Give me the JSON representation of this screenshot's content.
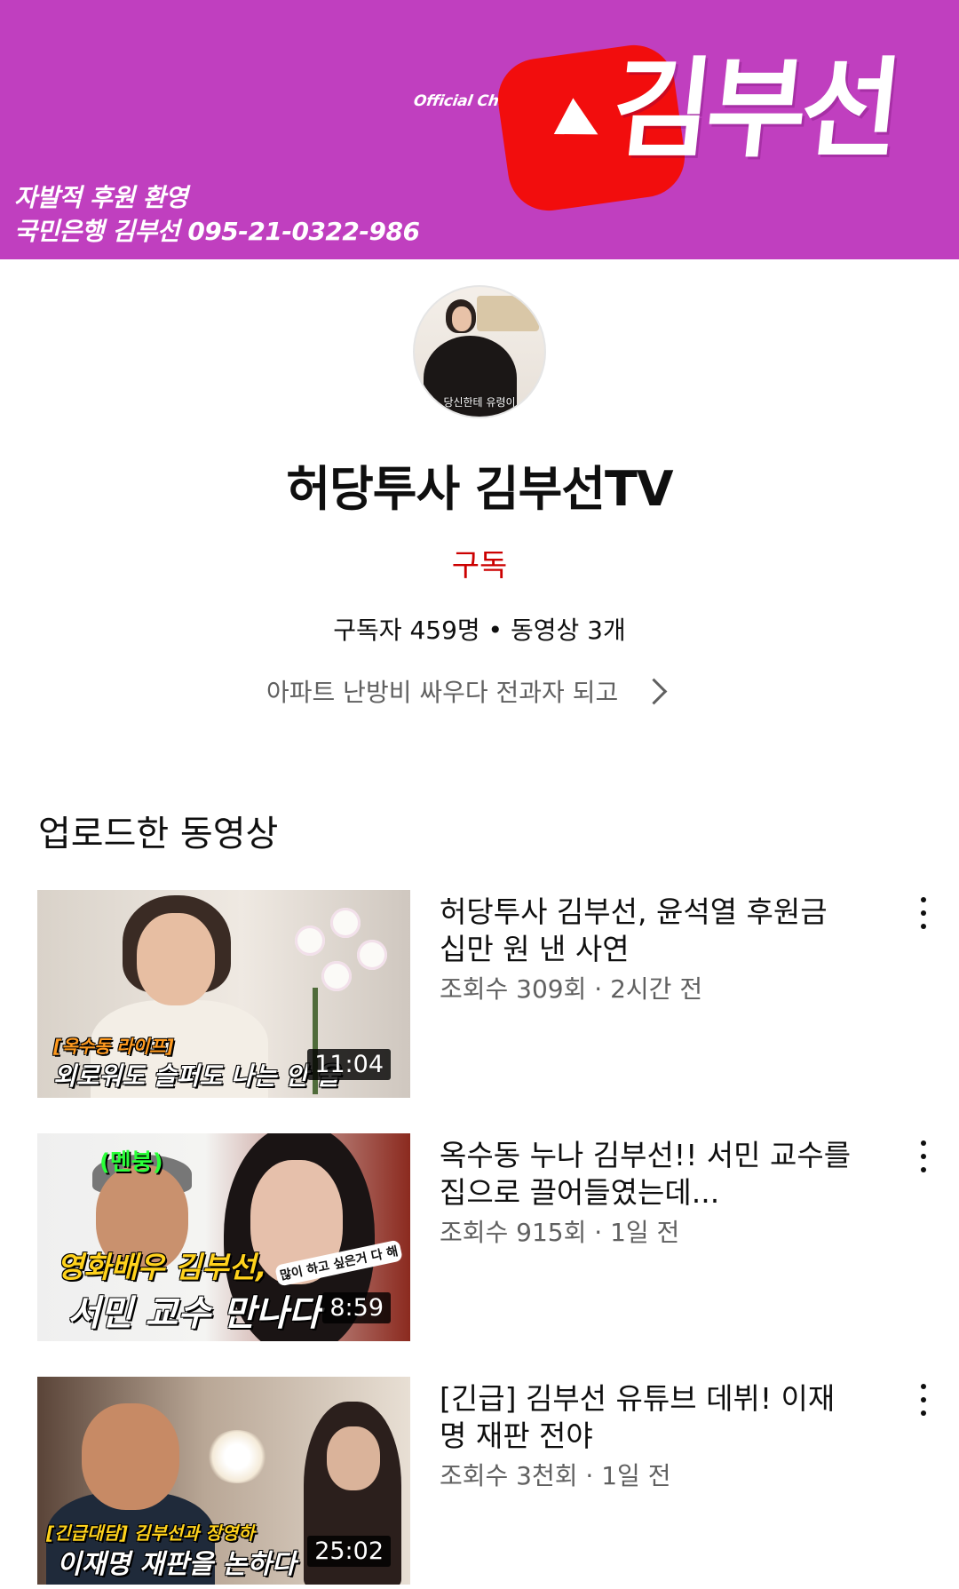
{
  "banner": {
    "official": "Official Channel",
    "name": "김부선",
    "donate_line1": "자발적 후원 환영",
    "donate_line2": "국민은행 김부선 095-21-0322-986",
    "colors": {
      "background": "#c03fbf",
      "badge": "#f20d0d"
    }
  },
  "channel": {
    "avatar_caption": "당신한테 유령이",
    "title": "허당투사 김부선TV",
    "subscribe_label": "구독",
    "stats": "구독자 459명 • 동영상 3개",
    "description": "아파트 난방비 싸우다 전과자 되고"
  },
  "uploads": {
    "section_title": "업로드한 동영상",
    "videos": [
      {
        "title": "허당투사 김부선, 윤석열 후원금 십만 원 낸 사연",
        "meta": "조회수 309회 · 2시간 전",
        "duration": "11:04",
        "thumb_caption1": "[옥수동 라이프]",
        "thumb_caption2": "외로워도 슬퍼도 나는 안 울"
      },
      {
        "title": "옥수동 누나 김부선!! 서민 교수를 집으로 끌어들였는데...",
        "meta": "조회수 915회 · 1일 전",
        "duration": "8:59",
        "thumb_bubble": "(멘붕)",
        "thumb_caption1": "영화배우 김부선,",
        "thumb_caption2": "서민 교수 만나다",
        "thumb_small": "많이 하고 싶은거 다 해"
      },
      {
        "title": "[긴급] 김부선 유튜브 데뷔! 이재명 재판 전야",
        "meta": "조회수 3천회 · 1일 전",
        "duration": "25:02",
        "thumb_caption1": "[긴급대담] 김부선과 장영하",
        "thumb_caption2": "이재명 재판을 논하다"
      }
    ]
  }
}
